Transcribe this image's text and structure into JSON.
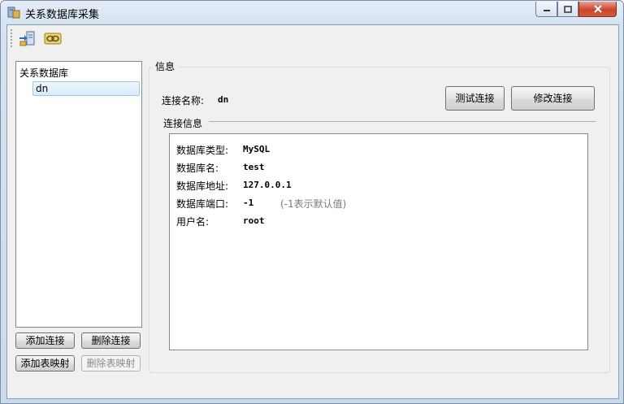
{
  "window": {
    "title": "关系数据库采集"
  },
  "toolbar": {
    "buttons": [
      {
        "icon": "export-database-icon"
      },
      {
        "icon": "link-icon"
      }
    ]
  },
  "tree": {
    "root_label": "关系数据库",
    "items": [
      {
        "label": "dn",
        "selected": true
      }
    ]
  },
  "left_buttons": {
    "add_connection": "添加连接",
    "delete_connection": "删除连接",
    "add_table_mapping": "添加表映射",
    "delete_table_mapping": "删除表映射"
  },
  "info": {
    "group_title": "信息",
    "connection_name_label": "连接名称:",
    "connection_name_value": "dn",
    "test_button": "测试连接",
    "edit_button": "修改连接",
    "connection_info_title": "连接信息",
    "fields": [
      {
        "label": "数据库类型:",
        "value": "MySQL"
      },
      {
        "label": "数据库名:",
        "value": "test"
      },
      {
        "label": "数据库地址:",
        "value": "127.0.0.1"
      },
      {
        "label": "数据库端口:",
        "value": "-1",
        "hint": "(-1表示默认值)"
      },
      {
        "label": "用户名:",
        "value": "root"
      }
    ]
  }
}
